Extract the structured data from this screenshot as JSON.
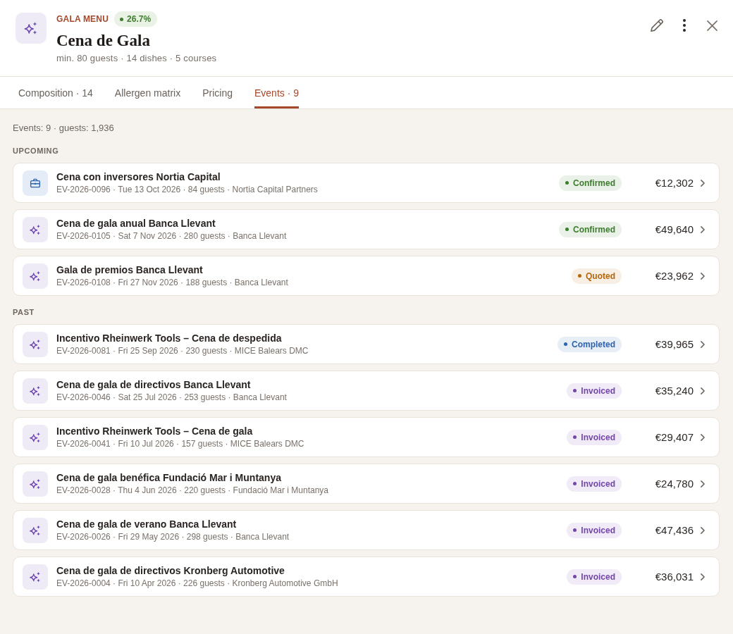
{
  "header": {
    "eyebrow": "GALA MENU",
    "badge": "26.7%",
    "title": "Cena de Gala",
    "subtitle": "min. 80 guests · 14 dishes · 5 courses"
  },
  "tabs": [
    {
      "label": "Composition · 14",
      "selected": false
    },
    {
      "label": "Allergen matrix",
      "selected": false
    },
    {
      "label": "Pricing",
      "selected": false
    },
    {
      "label": "Events · 9",
      "selected": true
    }
  ],
  "summary": "Events: 9 · guests: 1,936",
  "sections": [
    {
      "heading": "UPCOMING",
      "events": [
        {
          "kind": "corporate",
          "title": "Cena con inversores Nortia Capital",
          "meta": "EV-2026-0096 · Tue 13 Oct 2026 · 84 guests · Nortia Capital Partners",
          "status": "Confirmed",
          "color": "#3d7d2d",
          "price": "€12,302"
        },
        {
          "kind": "gala",
          "title": "Cena de gala anual Banca Llevant",
          "meta": "EV-2026-0105 · Sat 7 Nov 2026 · 280 guests · Banca Llevant",
          "status": "Confirmed",
          "color": "#3d7d2d",
          "price": "€49,640"
        },
        {
          "kind": "gala",
          "title": "Gala de premios Banca Llevant",
          "meta": "EV-2026-0108 · Fri 27 Nov 2026 · 188 guests · Banca Llevant",
          "status": "Quoted",
          "color": "#b3670c",
          "price": "€23,962"
        }
      ]
    },
    {
      "heading": "PAST",
      "events": [
        {
          "kind": "gala",
          "title": "Incentivo Rheinwerk Tools – Cena de despedida",
          "meta": "EV-2026-0081 · Fri 25 Sep 2026 · 230 guests · MICE Balears DMC",
          "status": "Completed",
          "color": "#2e63ad",
          "price": "€39,965"
        },
        {
          "kind": "gala",
          "title": "Cena de gala de directivos Banca Llevant",
          "meta": "EV-2026-0046 · Sat 25 Jul 2026 · 253 guests · Banca Llevant",
          "status": "Invoiced",
          "color": "#7446ad",
          "price": "€35,240"
        },
        {
          "kind": "gala",
          "title": "Incentivo Rheinwerk Tools – Cena de gala",
          "meta": "EV-2026-0041 · Fri 10 Jul 2026 · 157 guests · MICE Balears DMC",
          "status": "Invoiced",
          "color": "#7446ad",
          "price": "€29,407"
        },
        {
          "kind": "gala",
          "title": "Cena de gala benéfica Fundació Mar i Muntanya",
          "meta": "EV-2026-0028 · Thu 4 Jun 2026 · 220 guests · Fundació Mar i Muntanya",
          "status": "Invoiced",
          "color": "#7446ad",
          "price": "€24,780"
        },
        {
          "kind": "gala",
          "title": "Cena de gala de verano Banca Llevant",
          "meta": "EV-2026-0026 · Fri 29 May 2026 · 298 guests · Banca Llevant",
          "status": "Invoiced",
          "color": "#7446ad",
          "price": "€47,436"
        },
        {
          "kind": "gala",
          "title": "Cena de gala de directivos Kronberg Automotive",
          "meta": "EV-2026-0004 · Fri 10 Apr 2026 · 226 guests · Kronberg Automotive GmbH",
          "status": "Invoiced",
          "color": "#7446ad",
          "price": "€36,031"
        }
      ]
    }
  ]
}
